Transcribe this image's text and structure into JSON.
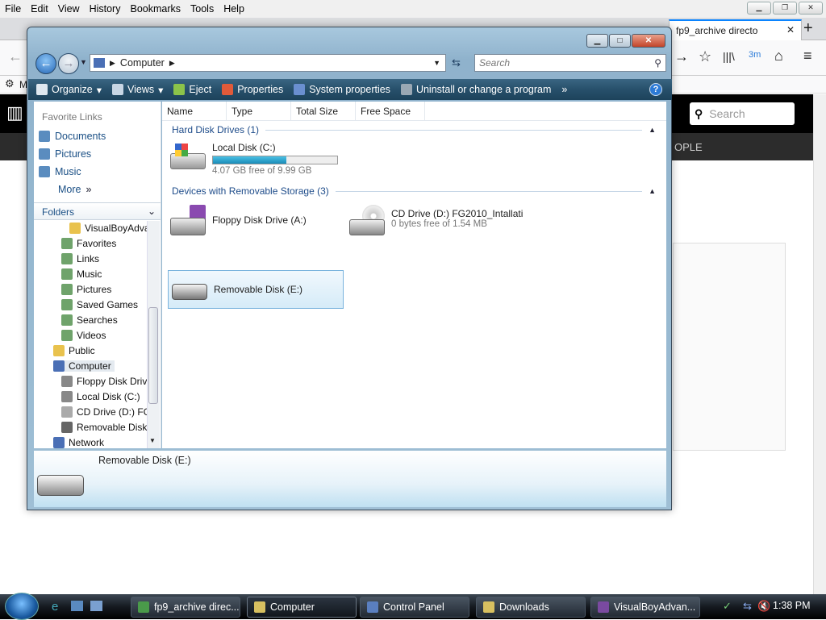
{
  "firefox": {
    "menu": [
      "File",
      "Edit",
      "View",
      "History",
      "Bookmarks",
      "Tools",
      "Help"
    ],
    "active_tab": "fp9_archive directo",
    "bookmark_bar_partial": "M",
    "site": {
      "search_placeholder": "Search",
      "nav_fragment": "OPLE"
    }
  },
  "explorer": {
    "address": "Computer",
    "search_placeholder": "Search",
    "toolbar": [
      "Organize",
      "Views",
      "Eject",
      "Properties",
      "System properties",
      "Uninstall or change a program",
      "»"
    ],
    "favorite_links_header": "Favorite Links",
    "favorites": [
      "Documents",
      "Pictures",
      "Music"
    ],
    "more_label": "More",
    "folders_label": "Folders",
    "tree": [
      {
        "label": "VisualBoyAdva",
        "color": "#e9c24d"
      },
      {
        "label": "Favorites",
        "color": "#6fa36b"
      },
      {
        "label": "Links",
        "color": "#6fa36b"
      },
      {
        "label": "Music",
        "color": "#6fa36b"
      },
      {
        "label": "Pictures",
        "color": "#6fa36b"
      },
      {
        "label": "Saved Games",
        "color": "#6fa36b"
      },
      {
        "label": "Searches",
        "color": "#6fa36b"
      },
      {
        "label": "Videos",
        "color": "#6fa36b"
      },
      {
        "label": "Public",
        "color": "#e9c24d"
      },
      {
        "label": "Computer",
        "color": "#4a6fb5"
      },
      {
        "label": "Floppy Disk Drive",
        "color": "#888"
      },
      {
        "label": "Local Disk (C:)",
        "color": "#888"
      },
      {
        "label": "CD Drive (D:) FG.",
        "color": "#aaa"
      },
      {
        "label": "Removable Disk",
        "color": "#666"
      },
      {
        "label": "Network",
        "color": "#4a6fb5"
      }
    ],
    "columns": [
      "Name",
      "Type",
      "Total Size",
      "Free Space"
    ],
    "groups": {
      "hard": "Hard Disk Drives (1)",
      "removable": "Devices with Removable Storage (3)"
    },
    "drives": {
      "c": {
        "name": "Local Disk (C:)",
        "free": "4.07 GB free of 9.99 GB",
        "used_fraction": 0.59
      },
      "a": {
        "name": "Floppy Disk Drive (A:)"
      },
      "d": {
        "name": "CD Drive (D:) FG2010_Intallati",
        "free": "0 bytes free of 1.54 MB"
      },
      "e": {
        "name": "Removable Disk (E:)"
      }
    },
    "details_title": "Removable Disk (E:)"
  },
  "taskbar": {
    "tasks": [
      {
        "label": "fp9_archive direc...",
        "color": "#4a9a4a"
      },
      {
        "label": "Computer",
        "color": "#d8c060"
      },
      {
        "label": "Control Panel",
        "color": "#5a7fc0"
      },
      {
        "label": "Downloads",
        "color": "#d8c060"
      },
      {
        "label": "VisualBoyAdvan...",
        "color": "#7a4aa0"
      }
    ],
    "clock": "1:38 PM"
  }
}
